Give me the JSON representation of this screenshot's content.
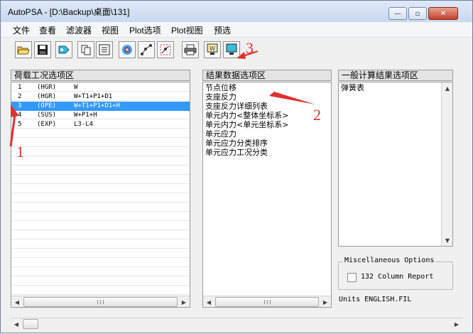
{
  "window": {
    "title": "AutoPSA - [D:\\Backup\\桌面\\131]",
    "min_glyph": "—",
    "max_glyph": "▫",
    "close_glyph": "✕"
  },
  "menu": [
    "文件",
    "查看",
    "滤波器",
    "视图",
    "Plot选项",
    "Plot视图",
    "预选"
  ],
  "toolbar": {
    "icons": [
      "open-folder-icon",
      "save-disk-icon",
      "filter-tag-icon",
      "copy-icon",
      "text-report-icon",
      "view-3d-icon",
      "graph-node-icon",
      "graph-select-icon",
      "printer-icon",
      "word-export-icon",
      "monitor-display-icon"
    ]
  },
  "load_cases": {
    "header": "荷载工况选项区",
    "rows": [
      {
        "num": "1",
        "type": "(HGR)",
        "combo": "W"
      },
      {
        "num": "2",
        "type": "(HGR)",
        "combo": "W+T1+P1+D1"
      },
      {
        "num": "3",
        "type": "(OPE)",
        "combo": "W+T1+P1+D1+H"
      },
      {
        "num": "4",
        "type": "(SUS)",
        "combo": "W+P1+H"
      },
      {
        "num": "5",
        "type": "(EXP)",
        "combo": "L3-L4"
      }
    ],
    "selected_index": 2
  },
  "results": {
    "header": "结果数据选项区",
    "items": [
      "节点位移",
      "支座反力",
      "支座反力详细列表",
      "单元内力<整体坐标系>",
      "单元内力<单元坐标系>",
      "单元应力",
      "单元应力分类排序",
      "单元应力工况分类"
    ]
  },
  "general": {
    "header": "一般计算结果选项区",
    "items": [
      "弹簧表"
    ]
  },
  "misc": {
    "legend": "Miscellaneous Options",
    "checkbox_label": "132 Column Report",
    "checked": false
  },
  "units_text": "Units ENGLISH.FIL",
  "annotations": [
    "1",
    "2",
    "3"
  ],
  "colors": {
    "selection": "#3399ff",
    "annotation": "#e03030"
  }
}
